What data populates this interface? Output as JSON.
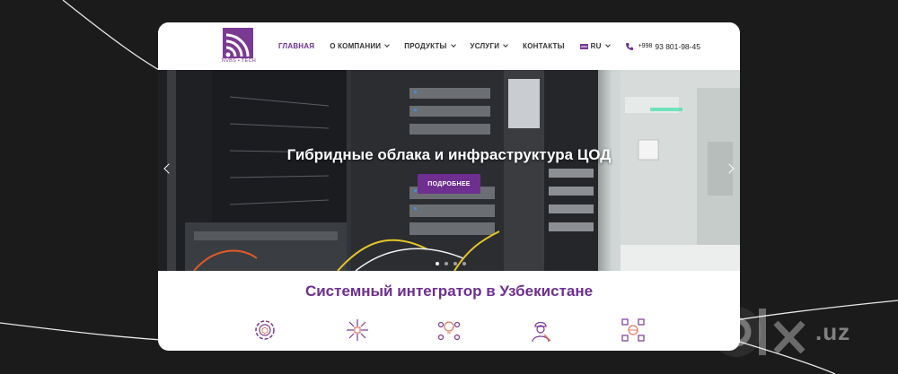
{
  "brand": {
    "logo_text": "NVBS • TECH",
    "color": "#6e2f91"
  },
  "nav": {
    "items": [
      {
        "label": "ГЛАВНАЯ",
        "active": true,
        "dropdown": false
      },
      {
        "label": "О КОМПАНИИ",
        "active": false,
        "dropdown": true
      },
      {
        "label": "ПРОДУКТЫ",
        "active": false,
        "dropdown": true
      },
      {
        "label": "УСЛУГИ",
        "active": false,
        "dropdown": true
      },
      {
        "label": "КОНТАКТЫ",
        "active": false,
        "dropdown": false
      }
    ],
    "language": "RU",
    "phone_prefix": "+998",
    "phone_number": "93 801-98-45"
  },
  "hero": {
    "title": "Гибридные облака и инфраструктура ЦОД",
    "button_label": "ПОДРОБНЕЕ",
    "slides_count": 4,
    "active_slide": 1
  },
  "section": {
    "title": "Системный интегратор в Узбекистане",
    "icons": [
      "gear-shield-icon",
      "network-hub-icon",
      "idea-people-icon",
      "engineer-icon",
      "global-network-icon"
    ]
  },
  "watermark": {
    "text": ".uz"
  }
}
